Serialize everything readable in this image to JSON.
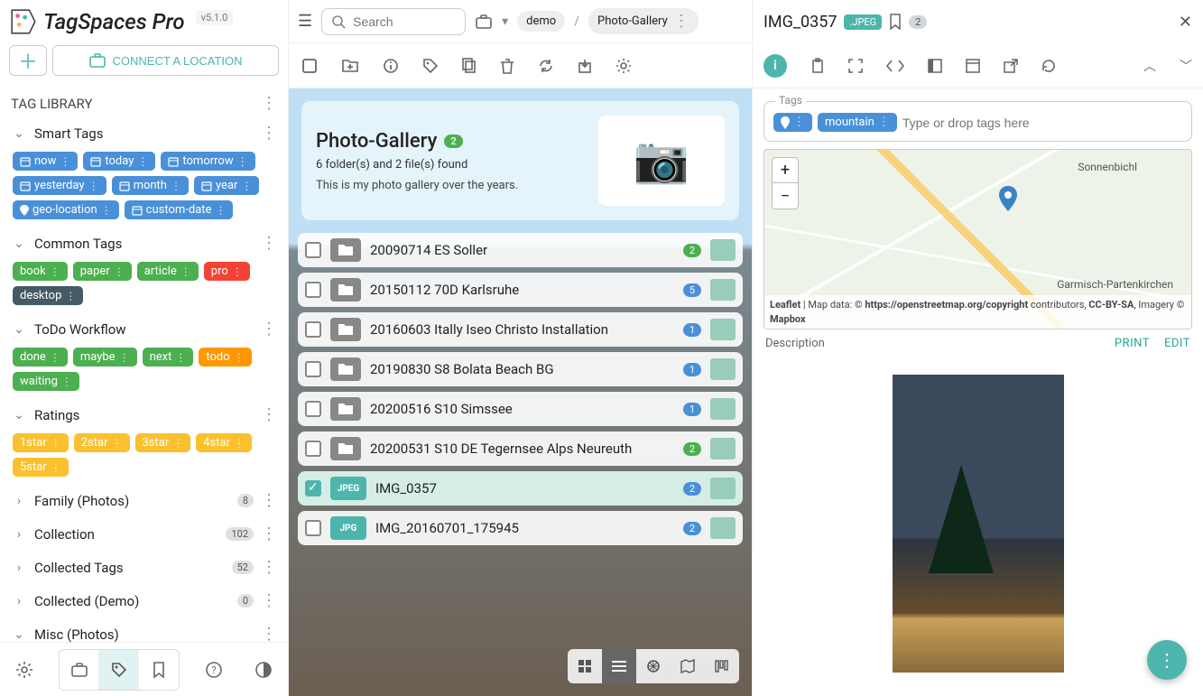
{
  "app": {
    "name": "TagSpaces Pro",
    "version": "v5.1.0"
  },
  "sidebar": {
    "connect_label": "CONNECT A LOCATION",
    "library_title": "TAG LIBRARY",
    "groups": [
      {
        "label": "Smart Tags",
        "open": true,
        "tags": [
          {
            "label": "now",
            "color": "t-blue",
            "icon": "cal"
          },
          {
            "label": "today",
            "color": "t-blue",
            "icon": "cal"
          },
          {
            "label": "tomorrow",
            "color": "t-blue",
            "icon": "cal"
          },
          {
            "label": "yesterday",
            "color": "t-blue",
            "icon": "cal"
          },
          {
            "label": "month",
            "color": "t-blue",
            "icon": "cal"
          },
          {
            "label": "year",
            "color": "t-blue",
            "icon": "cal"
          },
          {
            "label": "geo-location",
            "color": "t-blue",
            "icon": "pin"
          },
          {
            "label": "custom-date",
            "color": "t-blue",
            "icon": "cal"
          }
        ]
      },
      {
        "label": "Common Tags",
        "open": true,
        "tags": [
          {
            "label": "book",
            "color": "t-green"
          },
          {
            "label": "paper",
            "color": "t-green"
          },
          {
            "label": "article",
            "color": "t-green"
          },
          {
            "label": "pro",
            "color": "t-red"
          },
          {
            "label": "desktop",
            "color": "t-dark"
          }
        ]
      },
      {
        "label": "ToDo Workflow",
        "open": true,
        "tags": [
          {
            "label": "done",
            "color": "t-green"
          },
          {
            "label": "maybe",
            "color": "t-green"
          },
          {
            "label": "next",
            "color": "t-green"
          },
          {
            "label": "todo",
            "color": "t-orange"
          },
          {
            "label": "waiting",
            "color": "t-green"
          }
        ]
      },
      {
        "label": "Ratings",
        "open": true,
        "tags": [
          {
            "label": "1star",
            "color": "t-yellow"
          },
          {
            "label": "2star",
            "color": "t-yellow"
          },
          {
            "label": "3star",
            "color": "t-yellow"
          },
          {
            "label": "4star",
            "color": "t-yellow"
          },
          {
            "label": "5star",
            "color": "t-yellow"
          }
        ]
      },
      {
        "label": "Family (Photos)",
        "open": false,
        "count": "8"
      },
      {
        "label": "Collection",
        "open": false,
        "count": "102"
      },
      {
        "label": "Collected Tags",
        "open": false,
        "count": "52"
      },
      {
        "label": "Collected (Demo)",
        "open": false,
        "count": "0"
      },
      {
        "label": "Misc (Photos)",
        "open": true
      }
    ]
  },
  "breadcrumb": {
    "loc": "demo",
    "folder": "Photo-Gallery"
  },
  "search": {
    "placeholder": "Search"
  },
  "gallery": {
    "title": "Photo-Gallery",
    "badge": "2",
    "subtitle": "6 folder(s) and 2 file(s) found",
    "description": "This is my photo gallery over the years."
  },
  "files": [
    {
      "type": "folder",
      "name": "20090714 ES Soller",
      "badge": "2",
      "bc": "badge-round"
    },
    {
      "type": "folder",
      "name": "20150112 70D Karlsruhe",
      "badge": "5",
      "bc": "badge-blue"
    },
    {
      "type": "folder",
      "name": "20160603 Itally Iseo Christo Installation",
      "badge": "1",
      "bc": "badge-blue"
    },
    {
      "type": "folder",
      "name": "20190830 S8 Bolata Beach BG",
      "badge": "1",
      "bc": "badge-blue"
    },
    {
      "type": "folder",
      "name": "20200516 S10 Simssee",
      "badge": "1",
      "bc": "badge-blue"
    },
    {
      "type": "folder",
      "name": "20200531 S10 DE Tegernsee Alps Neureuth",
      "badge": "2",
      "bc": "badge-round"
    },
    {
      "type": "jpeg",
      "name": "IMG_0357",
      "badge": "2",
      "bc": "badge-blue",
      "selected": true
    },
    {
      "type": "jpg",
      "name": "IMG_20160701_175945",
      "badge": "2",
      "bc": "badge-blue"
    }
  ],
  "detail": {
    "title": "IMG_0357",
    "ext": ".JPEG",
    "count": "2",
    "tags": [
      {
        "label": "",
        "icon": "pin"
      },
      {
        "label": "mountain"
      }
    ],
    "tags_placeholder": "Type or drop tags here",
    "tags_legend": "Tags",
    "map": {
      "place1": "Sonnenbichl",
      "place2": "Garmisch-Partenkirchen",
      "attr_leaflet": "Leaflet",
      "attr_mid": " | Map data: © ",
      "attr_osm": "https://openstreetmap.org/copyright",
      "attr_contrib": " contributors, ",
      "attr_cc": "CC-BY-SA",
      "attr_img": ", Imagery © ",
      "attr_mb": "Mapbox"
    },
    "desc_label": "Description",
    "print": "PRINT",
    "edit": "EDIT"
  }
}
